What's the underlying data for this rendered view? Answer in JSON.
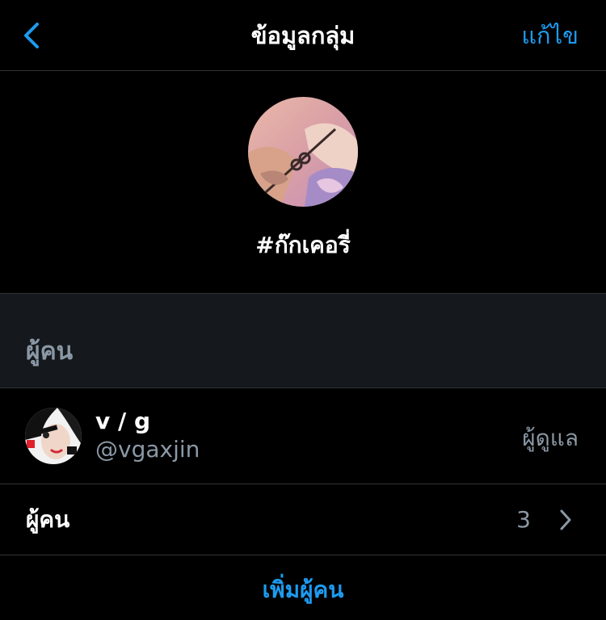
{
  "colors": {
    "accent": "#1d9bf0",
    "background": "#000000",
    "section_background": "#15181c",
    "divider": "#2f3336",
    "primary_text": "#ffffff",
    "secondary_text": "#8b98a5"
  },
  "nav": {
    "back_icon": "chevron-left-icon",
    "title": "ข้อมูลกลุ่ม",
    "edit_label": "แก้ไข"
  },
  "group": {
    "name": "#ก๊กเคอรี่"
  },
  "people_section": {
    "header": "ผู้คน"
  },
  "member": {
    "display_name": "v / g",
    "handle": "@vgaxjin",
    "role": "ผู้ดูแล"
  },
  "people_row": {
    "label": "ผู้คน",
    "count": "3",
    "chevron_icon": "chevron-right-icon"
  },
  "add_people_label": "เพิ่มผู้คน"
}
